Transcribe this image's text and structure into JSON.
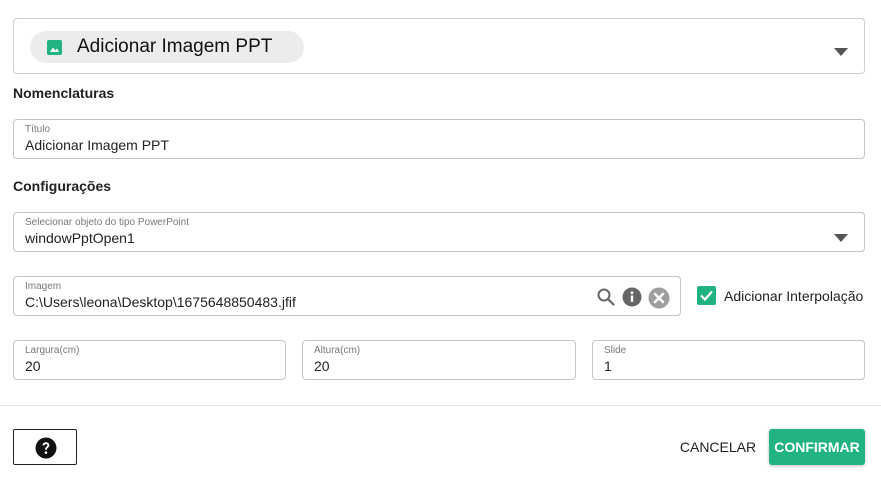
{
  "header": {
    "title": "Adicionar Imagem PPT",
    "icon": "image-icon"
  },
  "sections": {
    "nomenclaturas": "Nomenclaturas",
    "configuracoes": "Configurações"
  },
  "fields": {
    "titulo": {
      "label": "Título",
      "value": "Adicionar Imagem PPT"
    },
    "ppt_object": {
      "label": "Selecionar objeto do tipo PowerPoint",
      "value": "windowPptOpen1"
    },
    "imagem": {
      "label": "Imagem",
      "value": "C:\\Users\\leona\\Desktop\\1675648850483.jfif"
    },
    "largura": {
      "label": "Largura(cm)",
      "value": "20"
    },
    "altura": {
      "label": "Altura(cm)",
      "value": "20"
    },
    "slide": {
      "label": "Slide",
      "value": "1"
    }
  },
  "interpolacao": {
    "label": "Adicionar Interpolação",
    "checked": true
  },
  "footer": {
    "cancel_label": "CANCELAR",
    "confirm_label": "CONFIRMAR"
  },
  "colors": {
    "accent": "#21b383",
    "border": "#c4c4c4",
    "chip_bg": "#ececec"
  }
}
